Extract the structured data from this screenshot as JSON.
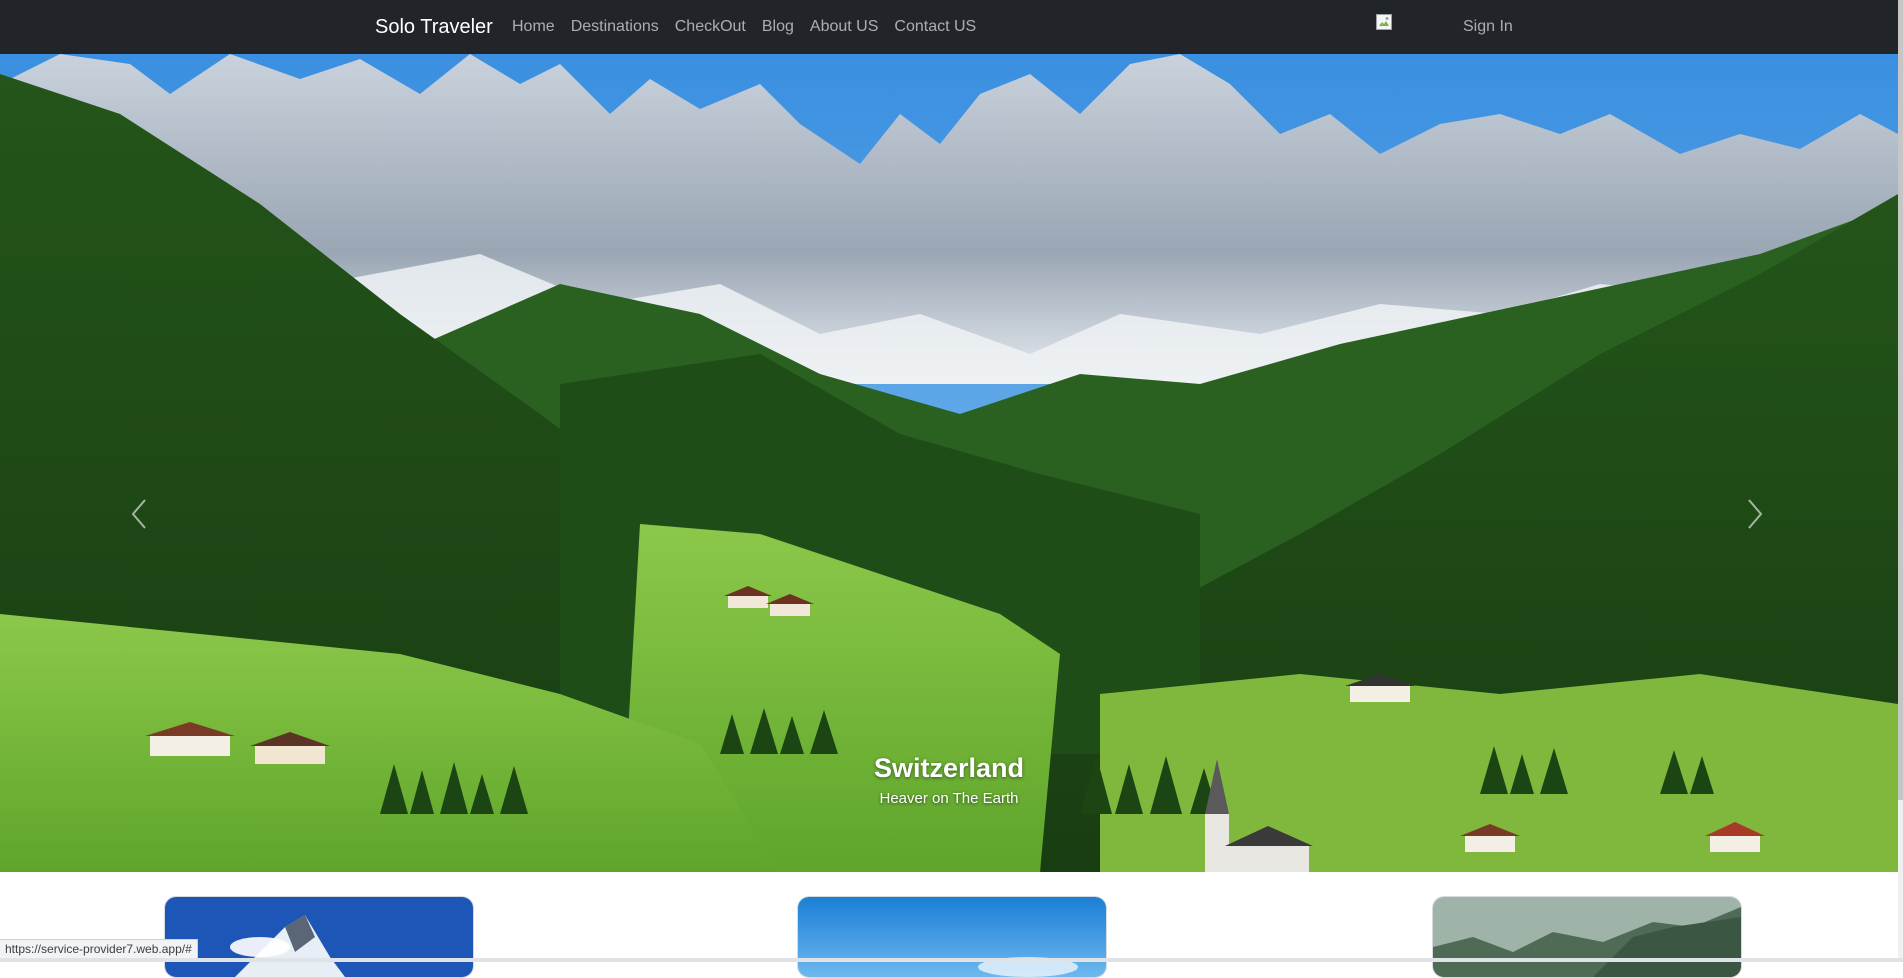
{
  "navbar": {
    "brand": "Solo Traveler",
    "links": [
      "Home",
      "Destinations",
      "CheckOut",
      "Blog",
      "About US",
      "Contact US"
    ],
    "sign_in": "Sign In",
    "background": "#212529"
  },
  "hero": {
    "slide": {
      "title": "Switzerland",
      "subtitle": "Heaver on The Earth"
    },
    "prev_icon": "chevron-left-icon",
    "next_icon": "chevron-right-icon",
    "indicators": {
      "count": 3,
      "active": 1
    }
  },
  "status_bar": {
    "url": "https://service-provider7.web.app/#"
  }
}
